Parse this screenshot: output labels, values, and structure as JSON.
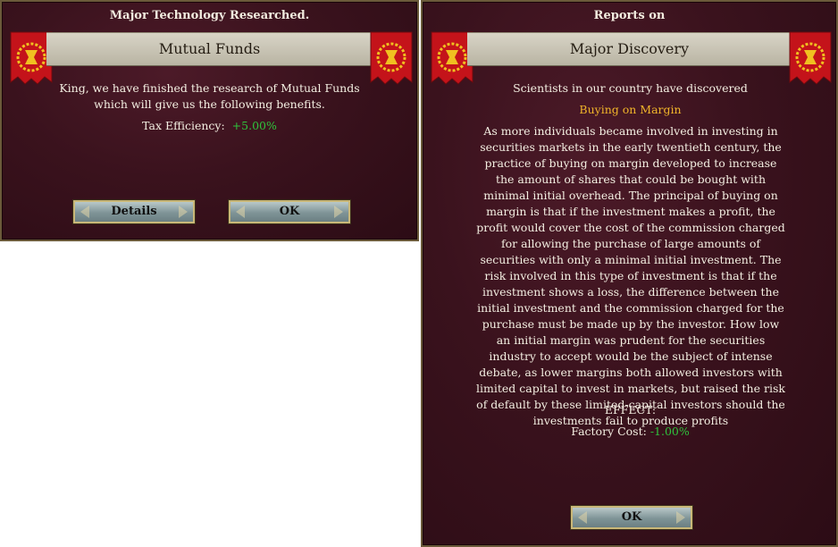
{
  "left": {
    "title": "Major Technology Researched.",
    "banner": "Mutual Funds",
    "message": "King, we have finished the research of Mutual Funds which will give us the following benefits.",
    "effect_label": "Tax Efficiency:",
    "effect_value": "+5.00%",
    "details_button": "Details",
    "ok_button": "OK"
  },
  "right": {
    "title": "Reports on",
    "banner": "Major Discovery",
    "intro": "Scientists in our country have discovered",
    "discovery": "Buying on Margin",
    "description": "As more individuals became involved in investing in securities markets in the early twentieth century, the practice of buying on margin developed to increase the amount of shares that could be bought with minimal initial overhead. The principal of buying on margin is that if the investment makes a profit, the profit would cover the cost of the commission charged for allowing the purchase of large amounts of securities with only a minimal initial investment. The risk involved in this type of investment is that if the investment shows a loss, the difference between the initial investment and the commission charged for the purchase must be made up by the investor. How low an initial margin was prudent for the securities industry to accept would be the subject of intense debate, as lower margins both allowed investors with limited capital to invest in markets, but raised the risk of default by these limited-capital investors should the investments fail to produce profits",
    "effect_heading": "EFFECT:",
    "effect_label": "Factory Cost:",
    "effect_value": "-1.00%",
    "ok_button": "OK"
  },
  "colors": {
    "effect_green": "#2fc23c",
    "discovery_gold": "#f0b42a",
    "panel_bg": "#3a121d"
  },
  "icons": [
    "royal-banner-icon"
  ]
}
